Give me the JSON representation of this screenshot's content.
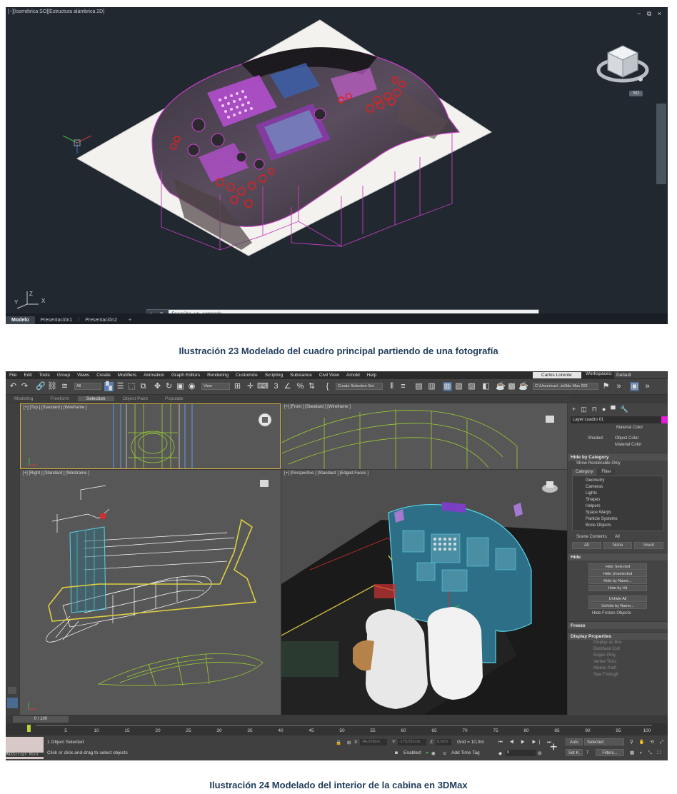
{
  "figure1": {
    "viewport_label": "[−][Isométrica SO][Estructura alámbrica 2D]",
    "window_controls": "− ⧉ ×",
    "viewcube_label": "SO",
    "command_placeholder": "Escriba un comando",
    "command_icons": "× ⚲",
    "tabs": [
      "Modelo",
      "Presentación1",
      "Presentación2"
    ],
    "add_tab": "+",
    "colors": {
      "background": "#212830",
      "outline": "#c23fc2",
      "red_markers": "#e0201e",
      "magenta_overlay": "#b94fd6"
    }
  },
  "caption1": "Ilustración 23 Modelado del cuadro principal partiendo de una fotografía",
  "figure2": {
    "menu": [
      "File",
      "Edit",
      "Tools",
      "Group",
      "Views",
      "Create",
      "Modifiers",
      "Animation",
      "Graph Editors",
      "Rendering",
      "Customize",
      "Scripting",
      "Substance",
      "Civil View",
      "Arnold",
      "Help"
    ],
    "user": "Carlos Lorente",
    "workspaces_label": "Workspaces:",
    "workspace": "Default",
    "toolbar": {
      "filter_all": "All",
      "view": "View",
      "selection_set": "Create Selection Set",
      "project_path": "C:\\Users\\carl...ts\\3ds Max 202"
    },
    "ribbon_tabs": [
      "Modeling",
      "Freeform",
      "Selection",
      "Object Paint",
      "Populate"
    ],
    "viewports": {
      "top": "[+] [Top ] [Standard ] [Wireframe ]",
      "front": "[+] [Front ] [Standard ] [Wireframe ]",
      "right": "[+] [Right ] [Standard ] [Wireframe ]",
      "perspective": "[+] [Perspective ] [Standard ] [Edged Faces ]"
    },
    "command_panel": {
      "layer": "Layer:cuadro 01",
      "material_color_top": "Material Color",
      "shaded_label": "Shaded:",
      "shaded_options": [
        "Object Color",
        "Material Color"
      ],
      "hide_by_category": "Hide by Category",
      "show_renderable": "Show Renderable Only",
      "subtabs": [
        "Category",
        "Filter"
      ],
      "categories": [
        "Geometry",
        "Cameras",
        "Lights",
        "Shapes",
        "Helpers",
        "Space Warps",
        "Particle Systems",
        "Bone Objects"
      ],
      "scene_contents": "Scene Contents",
      "scene_all": "All",
      "buttons_all_none_invert": [
        "All",
        "None",
        "Invert"
      ],
      "hide_title": "Hide",
      "hide_buttons": [
        "Hide Selected",
        "Hide Unselected",
        "Hide by Name...",
        "Hide by Hit"
      ],
      "unhide_buttons": [
        "Unhide All",
        "Unhide by Name..."
      ],
      "hide_frozen": "Hide Frozen Objects",
      "freeze_title": "Freeze",
      "display_props_title": "Display Properties",
      "display_props": [
        "Display as Box",
        "Backface Cull",
        "Edges Only",
        "Vertex Ticks",
        "Motion Path",
        "See-Through"
      ]
    },
    "time_slider": "0 / 100",
    "track_ticks": [
      "5",
      "10",
      "15",
      "20",
      "25",
      "30",
      "35",
      "40",
      "45",
      "50",
      "55",
      "60",
      "65",
      "70",
      "75",
      "80",
      "85",
      "90",
      "95",
      "100"
    ],
    "status": {
      "maxscript": "MAXScript Mini",
      "selected": "1 Object Selected",
      "hint": "Click or click-and-drag to select objects",
      "x_label": "X:",
      "x_value": "-84,229cm",
      "y_label": "Y:",
      "y_value": "-175,051cm",
      "z_label": "Z:",
      "z_value": "0,0cm",
      "grid": "Grid = 10,0m",
      "enabled": "Enabled:",
      "add_time_tag": "Add Time Tag",
      "auto": "Auto",
      "selected_dd": "Selected",
      "set_k": "Set K.",
      "filters": "Filters...",
      "frame": "0"
    },
    "colors": {
      "ui": "#3b3b3b",
      "viewport": "#575757",
      "active_border": "#d9b640",
      "cyan": "#59d2e6",
      "yellow": "#e0d040",
      "green_wire": "#9acd32",
      "magenta": "#e21cd9"
    }
  },
  "caption2": "Ilustración 24 Modelado del interior de la cabina en 3DMax"
}
